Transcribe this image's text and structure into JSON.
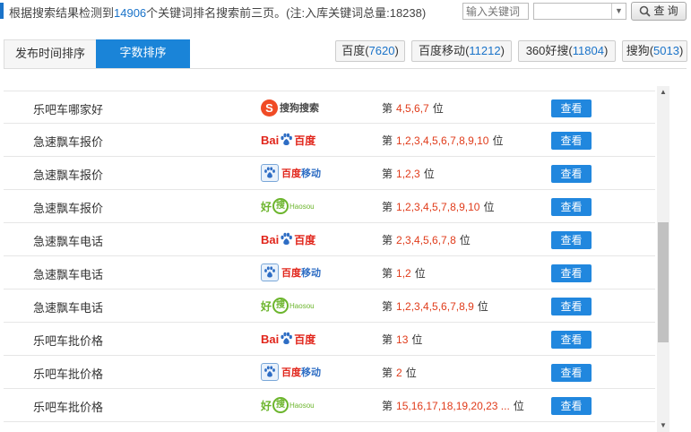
{
  "header": {
    "summary_prefix": "根据搜索结果检测到",
    "keyword_count": "14906",
    "summary_suffix": "个关键词排名搜索前三页。(注:入库关键词总量:18238)",
    "keyword_input_placeholder": "输入关键词",
    "select_value": "",
    "query_button": "查 询"
  },
  "sort_tabs": [
    {
      "label": "发布时间排序",
      "active": false
    },
    {
      "label": "字数排序",
      "active": true
    }
  ],
  "engine_tabs": [
    {
      "label": "百度",
      "count": "7620"
    },
    {
      "label": "百度移动",
      "count": "11212"
    },
    {
      "label": "360好搜",
      "count": "11804"
    },
    {
      "label": "搜狗",
      "count": "5013"
    }
  ],
  "logos": {
    "sogou": {
      "mark": "S",
      "text": "搜狗搜索"
    },
    "baidu": {
      "bai": "Bai",
      "du": "百度"
    },
    "mobile": {
      "red": "百度",
      "blue": "移动"
    },
    "haosou": {
      "hao": "好",
      "sou": "搜",
      "en": "Haosou"
    }
  },
  "rank_prefix": "第",
  "rank_suffix": "位",
  "view_label": "查看",
  "rows": [
    {
      "keyword": "乐吧车哪家好",
      "engine": "sogou",
      "positions": "4,5,6,7"
    },
    {
      "keyword": "急速飘车报价",
      "engine": "baidu",
      "positions": "1,2,3,4,5,6,7,8,9,10"
    },
    {
      "keyword": "急速飘车报价",
      "engine": "mobile",
      "positions": "1,2,3"
    },
    {
      "keyword": "急速飘车报价",
      "engine": "haosou",
      "positions": "1,2,3,4,5,7,8,9,10"
    },
    {
      "keyword": "急速飘车电话",
      "engine": "baidu",
      "positions": "2,3,4,5,6,7,8"
    },
    {
      "keyword": "急速飘车电话",
      "engine": "mobile",
      "positions": "1,2"
    },
    {
      "keyword": "急速飘车电话",
      "engine": "haosou",
      "positions": "1,2,3,4,5,6,7,8,9"
    },
    {
      "keyword": "乐吧车批价格",
      "engine": "baidu",
      "positions": "13"
    },
    {
      "keyword": "乐吧车批价格",
      "engine": "mobile",
      "positions": "2"
    },
    {
      "keyword": "乐吧车批价格",
      "engine": "haosou",
      "positions": "15,16,17,18,19,20,23 ..."
    }
  ],
  "colors": {
    "accent": "#1a84d8",
    "rank_red": "#e03b1a",
    "view_button": "#2187de"
  }
}
